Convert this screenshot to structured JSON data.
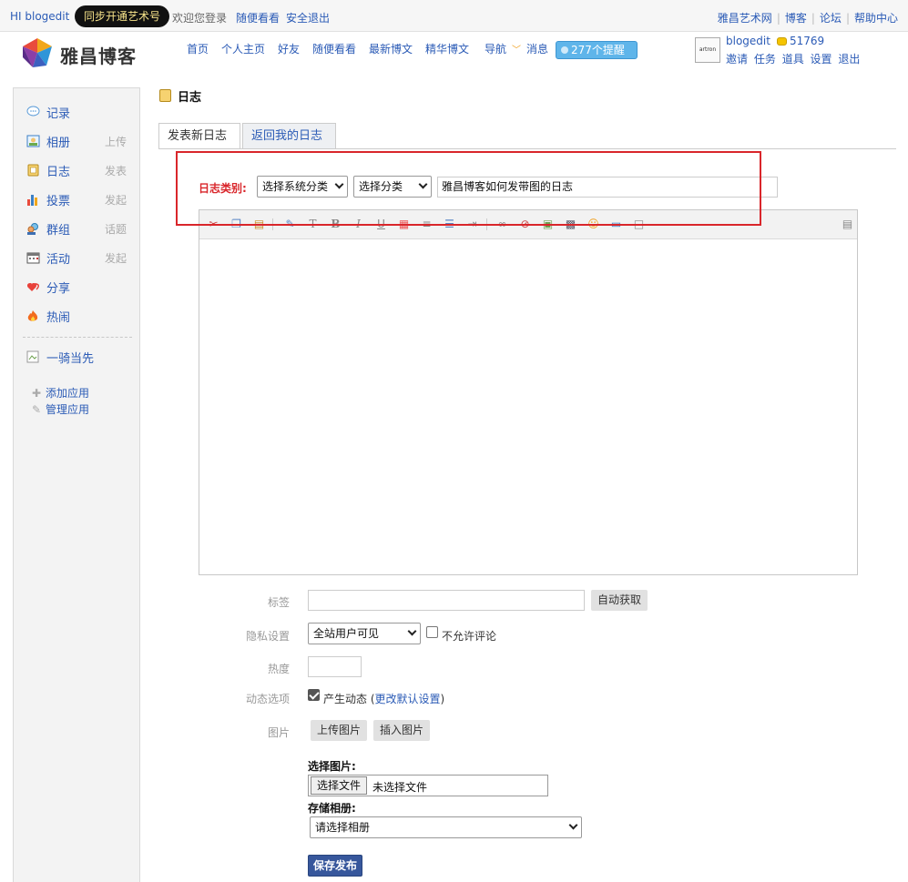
{
  "topbar": {
    "hi_text": "HI blogedit",
    "sync_button": "同步开通艺术号",
    "welcome": "欢迎您登录",
    "browse": "随便看看",
    "logout": "安全退出",
    "right_links": [
      "雅昌艺术网",
      "博客",
      "论坛",
      "帮助中心"
    ]
  },
  "header": {
    "logo_text": "雅昌博客",
    "nav": [
      "首页",
      "个人主页",
      "好友",
      "随便看看",
      "最新博文",
      "精华博文",
      "导航",
      "消息"
    ],
    "remind": "277个提醒",
    "user": {
      "name": "blogedit",
      "coins": "51769",
      "avatar_text": "artron",
      "links": [
        "邀请",
        "任务",
        "道具",
        "设置",
        "退出"
      ]
    }
  },
  "sidebar": {
    "items": [
      {
        "label": "记录",
        "extra": "",
        "icon": "chat-icon"
      },
      {
        "label": "相册",
        "extra": "上传",
        "icon": "photo-icon"
      },
      {
        "label": "日志",
        "extra": "发表",
        "icon": "notebook-icon"
      },
      {
        "label": "投票",
        "extra": "发起",
        "icon": "bar-chart-icon"
      },
      {
        "label": "群组",
        "extra": "话题",
        "icon": "group-icon"
      },
      {
        "label": "活动",
        "extra": "发起",
        "icon": "calendar-icon"
      },
      {
        "label": "分享",
        "extra": "",
        "icon": "heart-icon"
      },
      {
        "label": "热闹",
        "extra": "",
        "icon": "fire-icon"
      }
    ],
    "app_item": "一骑当先",
    "add_app": "添加应用",
    "manage_app": "管理应用"
  },
  "main": {
    "page_title": "日志",
    "tabs": [
      "发表新日志",
      "返回我的日志"
    ],
    "category_label": "日志类别:",
    "system_category": "选择系统分类",
    "category": "选择分类",
    "title_value": "雅昌博客如何发带图的日志",
    "form": {
      "tags_label": "标签",
      "auto_fetch": "自动获取",
      "privacy_label": "隐私设置",
      "privacy_value": "全站用户可见",
      "no_comment": "不允许评论",
      "heat_label": "热度",
      "feed_label": "动态选项",
      "feed_text": "产生动态",
      "feed_link_open": "(",
      "feed_link": "更改默认设置",
      "feed_link_close": ")",
      "image_label": "图片",
      "upload_image": "上传图片",
      "insert_image": "插入图片",
      "choose_image_label": "选择图片:",
      "choose_file": "选择文件",
      "no_file": "未选择文件",
      "album_label": "存储相册:",
      "album_select": "请选择相册",
      "save_publish": "保存发布"
    }
  },
  "colors": {
    "link": "#2b5bb6",
    "highlight_red": "#d9262b",
    "remind_blue": "#5fb5ea",
    "save_button": "#37579c"
  }
}
